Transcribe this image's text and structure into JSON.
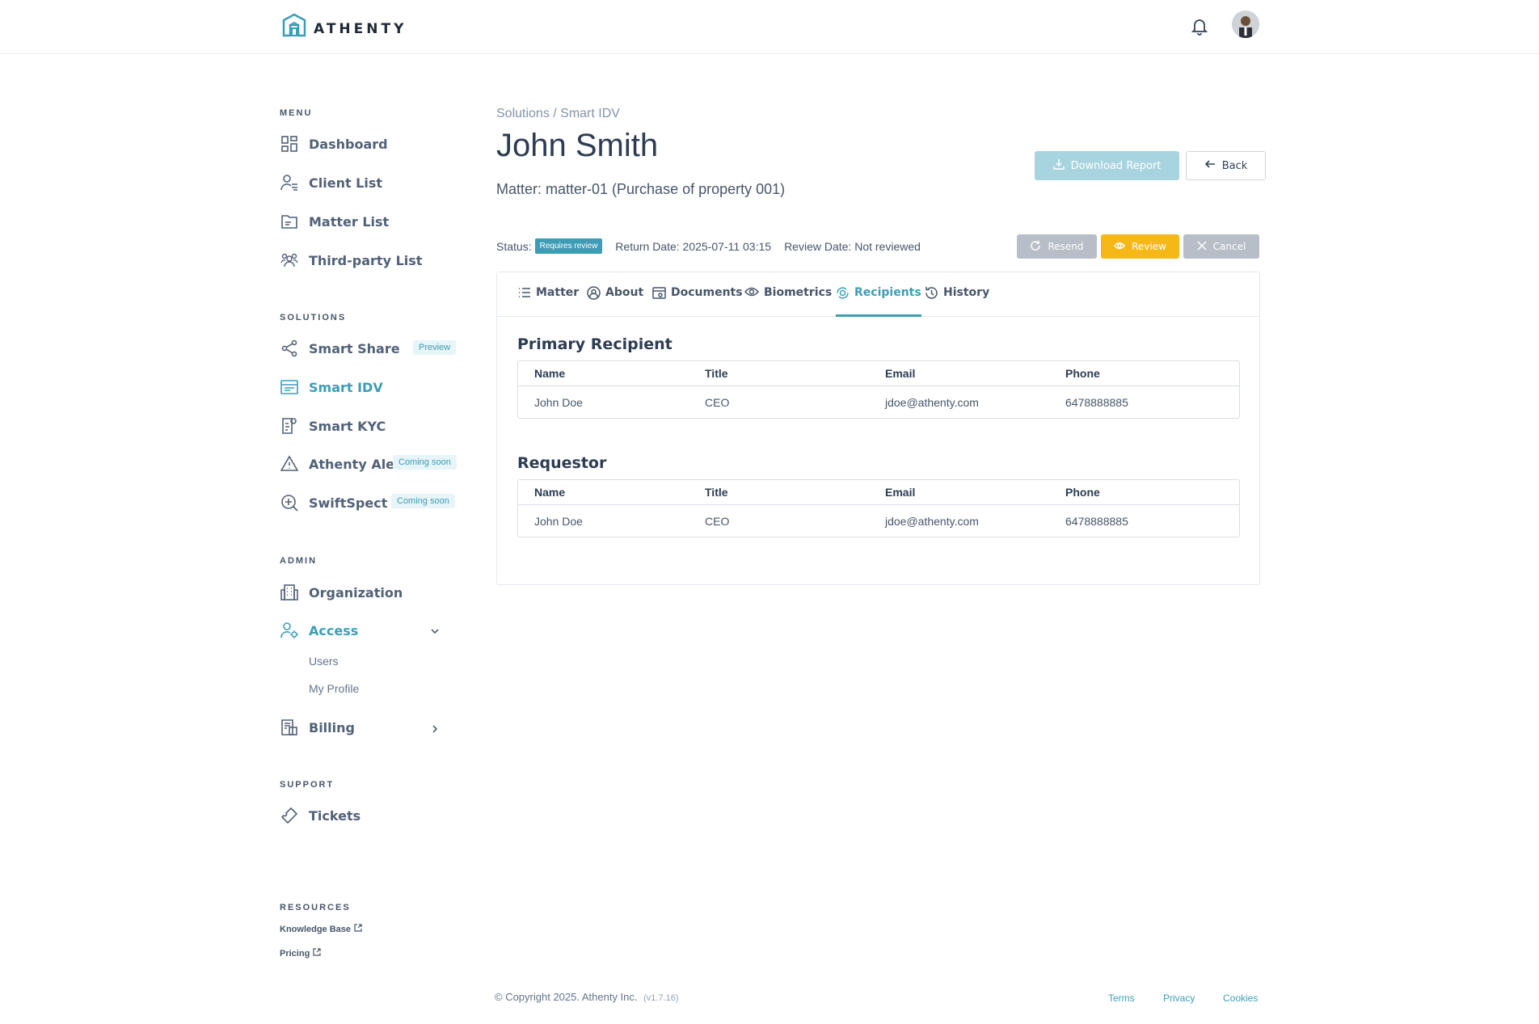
{
  "header": {
    "brand": "ATHENTY"
  },
  "sidebar": {
    "menu_title": "MENU",
    "menu": [
      {
        "label": "Dashboard",
        "icon": "grid-icon"
      },
      {
        "label": "Client List",
        "icon": "user-list-icon"
      },
      {
        "label": "Matter List",
        "icon": "folder-icon"
      },
      {
        "label": "Third-party List",
        "icon": "group-icon"
      }
    ],
    "solutions_title": "SOLUTIONS",
    "solutions": [
      {
        "label": "Smart Share",
        "icon": "share-icon",
        "badge": "Preview"
      },
      {
        "label": "Smart IDV",
        "icon": "id-card-icon",
        "badge": ""
      },
      {
        "label": "Smart KYC",
        "icon": "kyc-doc-icon",
        "badge": ""
      },
      {
        "label": "Athenty Alert",
        "icon": "alert-triangle-icon",
        "badge": "Coming soon"
      },
      {
        "label": "SwiftSpect",
        "icon": "zoom-in-icon",
        "badge": "Coming soon"
      }
    ],
    "admin_title": "ADMIN",
    "admin": [
      {
        "label": "Organization",
        "icon": "building-icon"
      },
      {
        "label": "Access",
        "icon": "user-gear-icon"
      },
      {
        "label": "Billing",
        "icon": "invoice-icon"
      }
    ],
    "access_sub": [
      "Users",
      "My Profile"
    ],
    "support_title": "SUPPORT",
    "support": [
      {
        "label": "Tickets",
        "icon": "ticket-icon"
      }
    ],
    "resources_title": "RESOURCES",
    "resources": [
      "Knowledge Base",
      "Pricing"
    ]
  },
  "main": {
    "breadcrumb": "Solutions / Smart IDV",
    "title": "John Smith",
    "matter": "Matter: matter-01 (Purchase of property 001)",
    "download_label": "Download Report",
    "back_label": "Back",
    "status_label": "Status:",
    "status_value": "Requires review",
    "return_date": "Return Date: 2025-07-11 03:15",
    "review_date": "Review Date: Not reviewed",
    "resend_label": "Resend",
    "review_label": "Review",
    "cancel_label": "Cancel",
    "tabs": [
      "Matter",
      "About",
      "Documents",
      "Biometrics",
      "Recipients",
      "History"
    ],
    "primary_title": "Primary Recipient",
    "requestor_title": "Requestor",
    "columns": [
      "Name",
      "Title",
      "Email",
      "Phone"
    ],
    "primary_row": [
      "John Doe",
      "CEO",
      "jdoe@athenty.com",
      "6478888885"
    ],
    "requestor_row": [
      "John Doe",
      "CEO",
      "jdoe@athenty.com",
      "6478888885"
    ]
  },
  "footer": {
    "copyright": "© Copyright 2025. Athenty Inc.",
    "version": "(v1.7.16)",
    "links": [
      "Terms",
      "Privacy",
      "Cookies"
    ]
  },
  "colors": {
    "accent": "#3d9db5",
    "review": "#f5b816",
    "disabled": "#b8bec7",
    "download": "#a8d4e0"
  }
}
